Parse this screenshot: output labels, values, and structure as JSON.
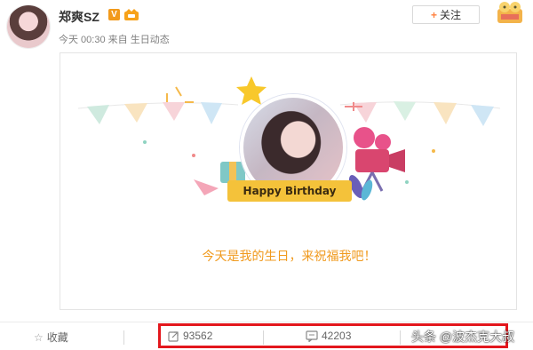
{
  "post": {
    "user_name": "郑爽SZ",
    "meta": "今天 00:30 来自 生日动态",
    "follow_label": "关注",
    "follow_plus": "+"
  },
  "card": {
    "ribbon_text": "Happy Birthday",
    "caption": "今天是我的生日，来祝福我吧！"
  },
  "footer": {
    "favorite_label": "收藏",
    "reposts": "93562",
    "comments": "42203",
    "watermark": "头条 @波杰克大叔"
  },
  "colors": {
    "accent_orange": "#f09a1e",
    "highlight_red": "#e3171d",
    "ribbon_yellow": "#f4c23a",
    "verified": "#f29a1b"
  }
}
